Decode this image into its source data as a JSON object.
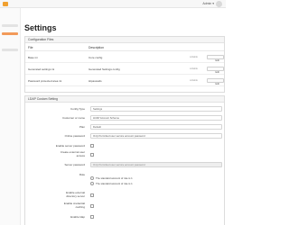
{
  "topbar": {
    "user_label": "Admin"
  },
  "page": {
    "title": "Settings"
  },
  "config_files": {
    "heading": "Configuration Files",
    "columns": {
      "file": "File",
      "description": "Description"
    },
    "rows": [
      {
        "path": "Base ini",
        "description": "Core config",
        "permissions": "writable",
        "button": "Edit"
      },
      {
        "path": "Generated settings ini",
        "description": "Generated Settings config",
        "permissions": "writable",
        "button": "Edit"
      },
      {
        "path": "Password protected area ini",
        "description": "Htpasswds",
        "permissions": "writable",
        "button": "Edit"
      }
    ]
  },
  "ldap": {
    "heading": "LDAP Custom Setting",
    "fields": [
      {
        "label": "Config Type",
        "value": "Settings",
        "disabled": false
      },
      {
        "label": "Customer or name",
        "value": "LDAP Account Scheme",
        "disabled": false
      },
      {
        "label": "Plan",
        "value": "Default",
        "disabled": false
      },
      {
        "label": "Online password",
        "value": "Only Permitted user service account password",
        "disabled": false
      }
    ],
    "checks_a": [
      {
        "label": "Enable server password"
      },
      {
        "label": "Create external user access"
      }
    ],
    "server_password": {
      "label": "Server password",
      "value": "Only Permitted user service account password"
    },
    "role": {
      "label": "Role",
      "options": [
        "The standard account of role is 1",
        "The standard account of role is 1"
      ]
    },
    "checks_b": [
      {
        "label": "Enable external directory server"
      },
      {
        "label": "Enable credential caching"
      },
      {
        "label": "Enable ldap"
      }
    ]
  }
}
